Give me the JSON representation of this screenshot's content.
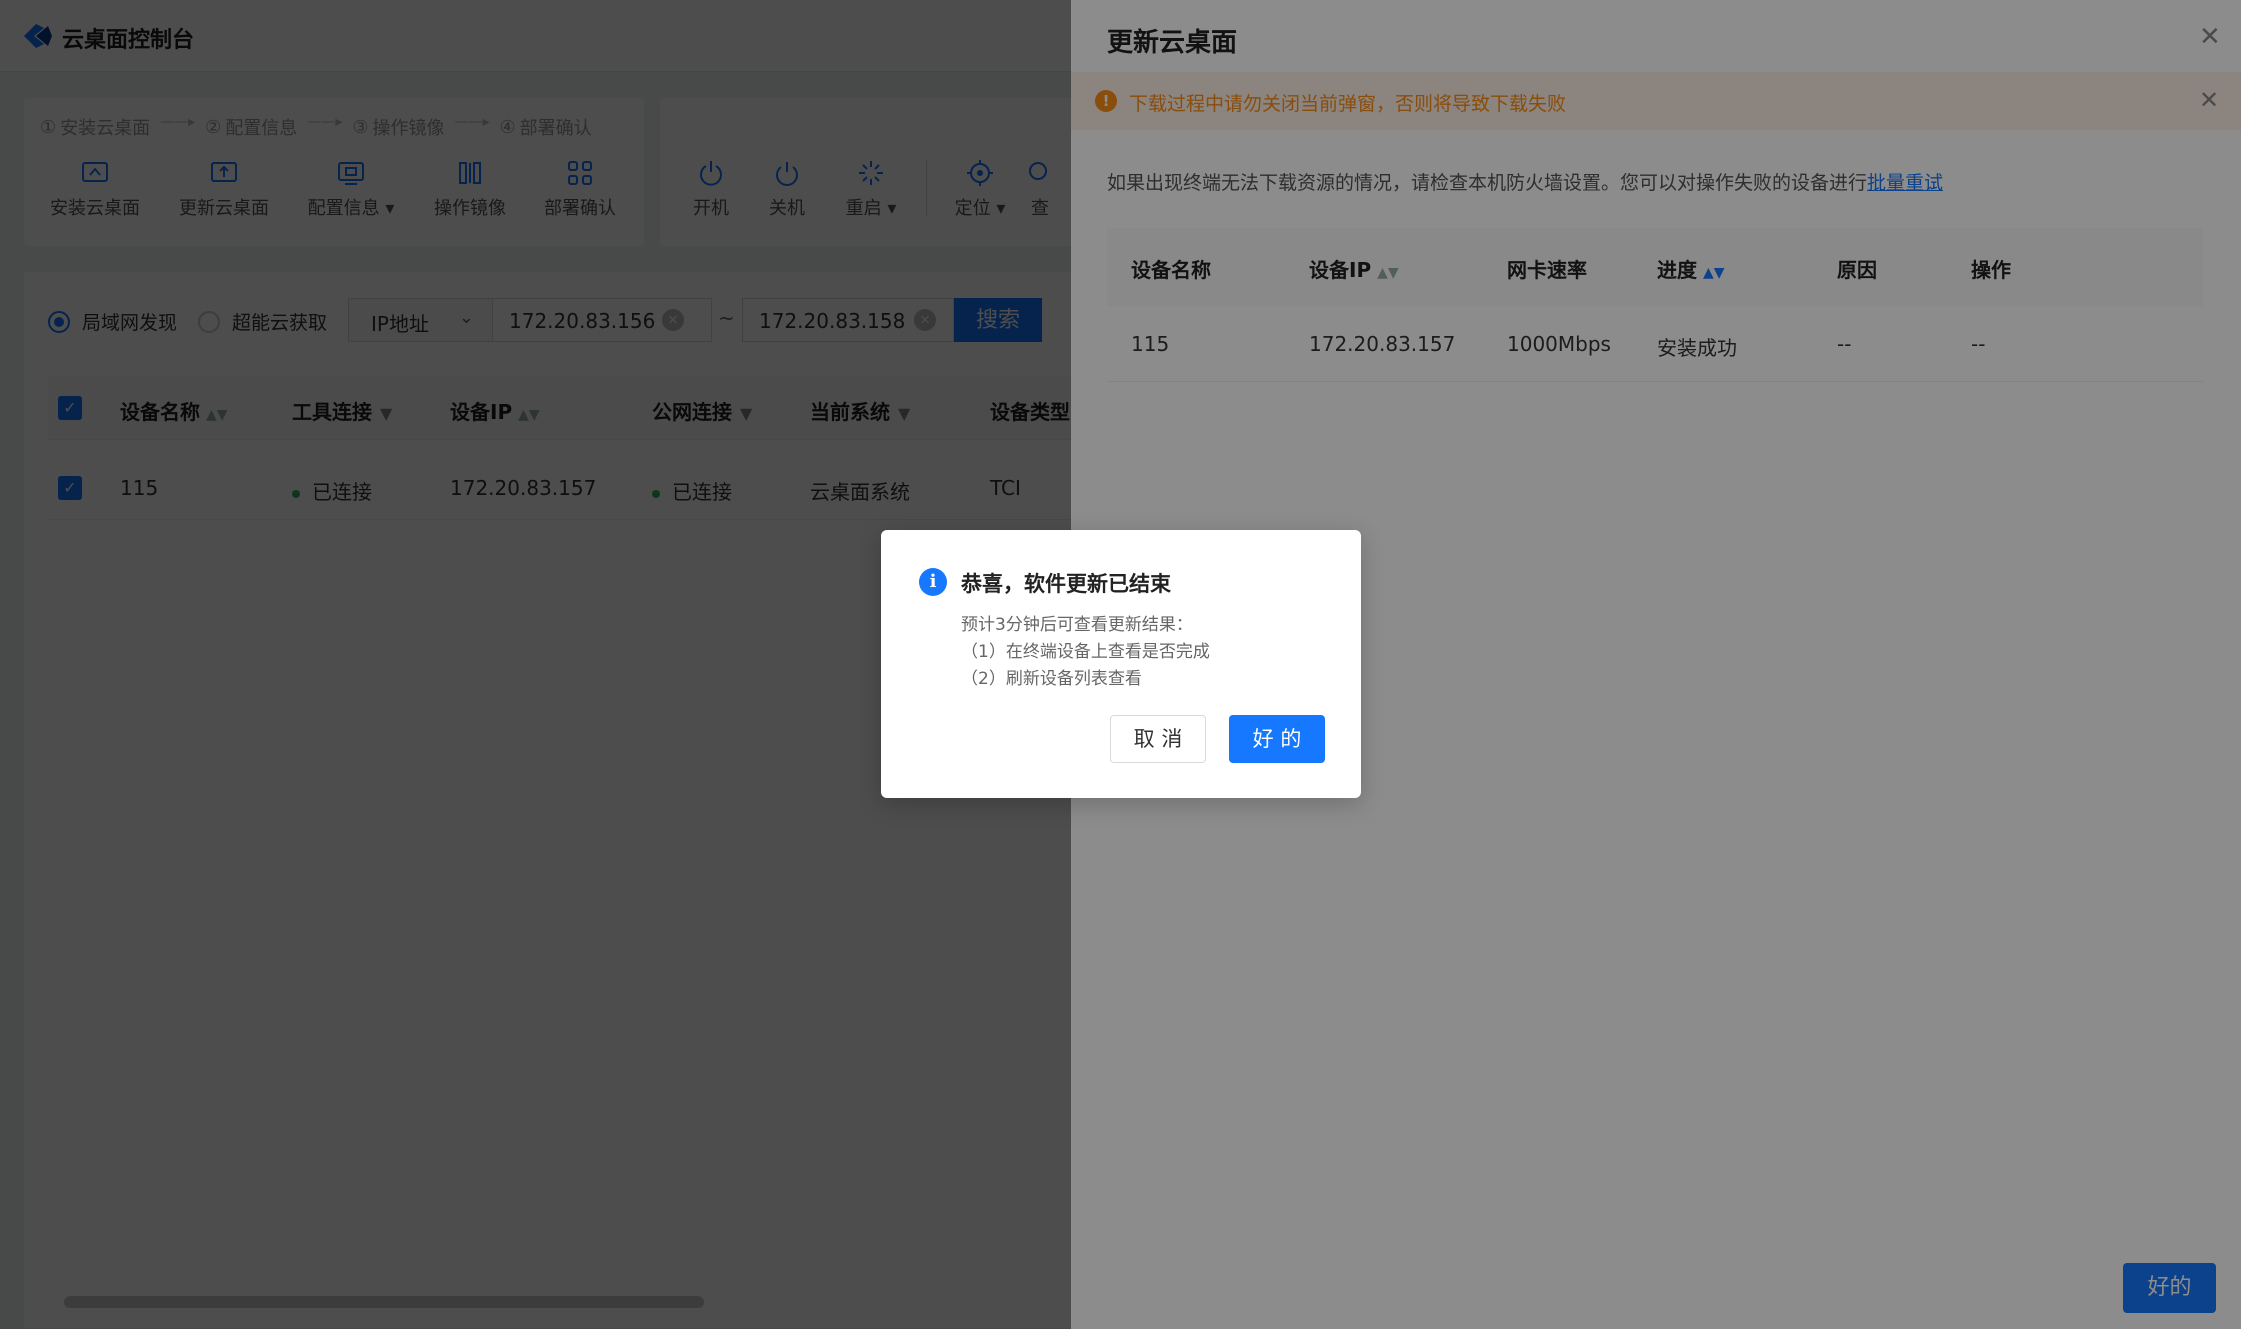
{
  "app": {
    "title": "云桌面控制台"
  },
  "steps": [
    {
      "num": "①",
      "label": "安装云桌面"
    },
    {
      "num": "②",
      "label": "配置信息"
    },
    {
      "num": "③",
      "label": "操作镜像"
    },
    {
      "num": "④",
      "label": "部署确认"
    }
  ],
  "toolbar": {
    "install": "安装云桌面",
    "update": "更新云桌面",
    "config": "配置信息",
    "image": "操作镜像",
    "deploy": "部署确认",
    "power_on": "开机",
    "power_off": "关机",
    "restart": "重启",
    "locate": "定位",
    "query": "查"
  },
  "search": {
    "mode_lan": "局域网发现",
    "mode_cloud": "超能云获取",
    "field_type": "IP地址",
    "ip_start": "172.20.83.156",
    "range_sep": "~",
    "ip_end": "172.20.83.158",
    "search_label": "搜索"
  },
  "device_table": {
    "columns": [
      "设备名称",
      "工具连接",
      "设备IP",
      "公网连接",
      "当前系统",
      "设备类型"
    ],
    "rows": [
      {
        "name": "115",
        "tool_conn": "已连接",
        "ip": "172.20.83.157",
        "public_conn": "已连接",
        "system": "云桌面系统",
        "type": "TCI"
      }
    ]
  },
  "drawer": {
    "title": "更新云桌面",
    "warning": "下载过程中请勿关闭当前弹窗，否则将导致下载失败",
    "hint": "如果出现终端无法下载资源的情况，请检查本机防火墙设置。您可以对操作失败的设备进行",
    "hint_link": "批量重试",
    "columns": [
      "设备名称",
      "设备IP",
      "网卡速率",
      "进度",
      "原因",
      "操作"
    ],
    "rows": [
      {
        "name": "115",
        "ip": "172.20.83.157",
        "speed": "1000Mbps",
        "progress": "安装成功",
        "reason": "--",
        "action": "--"
      }
    ],
    "ok_label": "好的"
  },
  "modal": {
    "title": "恭喜，软件更新已结束",
    "line1": "预计3分钟后可查看更新结果：",
    "line2": "（1）在终端设备上查看是否完成",
    "line3": "（2）刷新设备列表查看",
    "cancel_label": "取 消",
    "ok_label": "好 的"
  },
  "colors": {
    "primary": "#1677ff",
    "warning": "#fa8c16",
    "success": "#2db55d"
  }
}
